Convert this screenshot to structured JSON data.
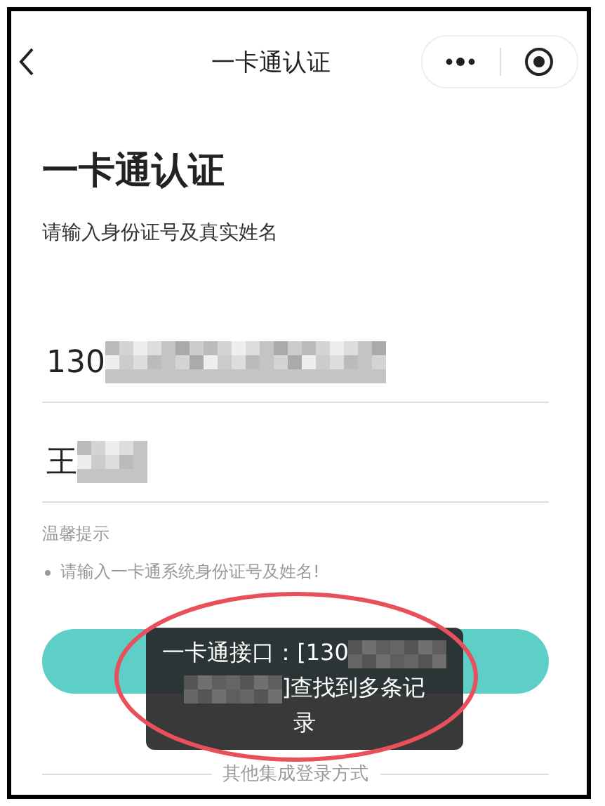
{
  "nav": {
    "title": "一卡通认证"
  },
  "heading": "一卡通认证",
  "subtitle": "请输入身份证号及真实姓名",
  "fields": [
    {
      "value": "130",
      "redacted": true
    },
    {
      "value": "王",
      "redacted": true
    }
  ],
  "tips": {
    "title": "温馨提示",
    "items": [
      "请输入一卡通系统身份证号及姓名!"
    ]
  },
  "toast": {
    "lines": [
      [
        {
          "kind": "text",
          "text": "一卡通接口：[130"
        },
        {
          "kind": "redacted"
        }
      ],
      [
        {
          "kind": "redacted"
        },
        {
          "kind": "text",
          "text": "]查找到多条记"
        }
      ],
      [
        {
          "kind": "text",
          "text": "录"
        }
      ]
    ]
  },
  "other_login": "其他集成登录方式"
}
